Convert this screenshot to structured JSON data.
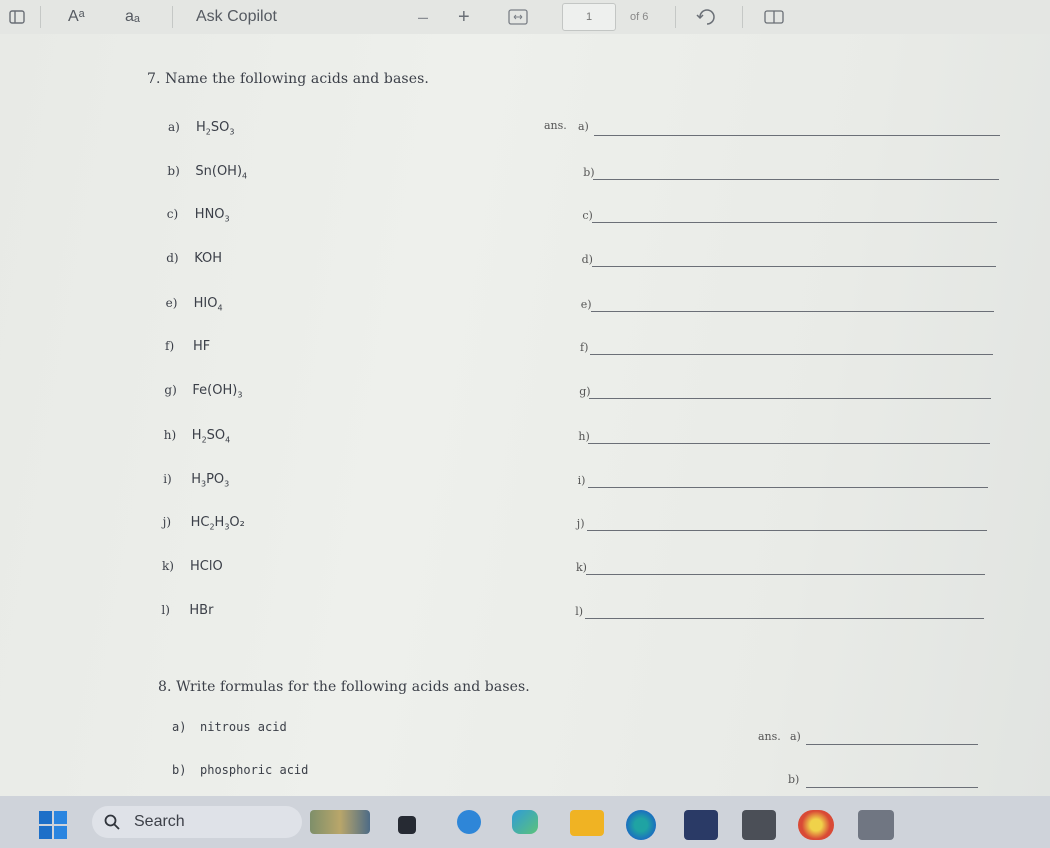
{
  "toolbar": {
    "text_size_icon": "Aᵃ",
    "read_aloud_icon": "aₐ",
    "ask_copilot": "Ask Copilot",
    "zoom_out": "–",
    "zoom_in": "+",
    "page_current": "1",
    "page_total": "of 6"
  },
  "worksheet": {
    "q7": {
      "title": "7.  Name the following acids and bases.",
      "ans_prefix": "ans.",
      "items": [
        {
          "letter": "a)",
          "formula": [
            "H",
            "2",
            "SO",
            "3",
            ""
          ],
          "answer_label": "a)"
        },
        {
          "letter": "b)",
          "formula": [
            "Sn(OH)",
            "4",
            "",
            "",
            ""
          ],
          "answer_label": "b)"
        },
        {
          "letter": "c)",
          "formula": [
            "HNO",
            "3",
            "",
            "",
            ""
          ],
          "answer_label": "c)"
        },
        {
          "letter": "d)",
          "formula": [
            "KOH",
            "",
            "",
            "",
            ""
          ],
          "answer_label": "d)"
        },
        {
          "letter": "e)",
          "formula": [
            "HIO",
            "4",
            "",
            "",
            ""
          ],
          "answer_label": "e)"
        },
        {
          "letter": "f)",
          "formula": [
            "HF",
            "",
            "",
            "",
            ""
          ],
          "answer_label": "f)"
        },
        {
          "letter": "g)",
          "formula": [
            "Fe(OH)",
            "3",
            "",
            "",
            ""
          ],
          "answer_label": "g)"
        },
        {
          "letter": "h)",
          "formula": [
            "H",
            "2",
            "SO",
            "4",
            ""
          ],
          "answer_label": "h)"
        },
        {
          "letter": "i)",
          "formula": [
            "H",
            "3",
            "PO",
            "3",
            ""
          ],
          "answer_label": "i)"
        },
        {
          "letter": "j)",
          "formula": [
            "HC",
            "2",
            "H",
            "3",
            "O₂"
          ],
          "answer_label": "j)"
        },
        {
          "letter": "k)",
          "formula": [
            "HClO",
            "",
            "",
            "",
            ""
          ],
          "answer_label": "k)"
        },
        {
          "letter": "l)",
          "formula": [
            "HBr",
            "",
            "",
            "",
            ""
          ],
          "answer_label": "l)"
        }
      ]
    },
    "q8": {
      "title": "8.  Write formulas for the following acids and bases.",
      "ans_prefix": "ans.",
      "items": [
        {
          "letter": "a)",
          "name": "nitrous acid",
          "answer_label": "a)"
        },
        {
          "letter": "b)",
          "name": "phosphoric acid",
          "answer_label": "b)"
        }
      ]
    }
  },
  "taskbar": {
    "search_placeholder": "Search"
  }
}
